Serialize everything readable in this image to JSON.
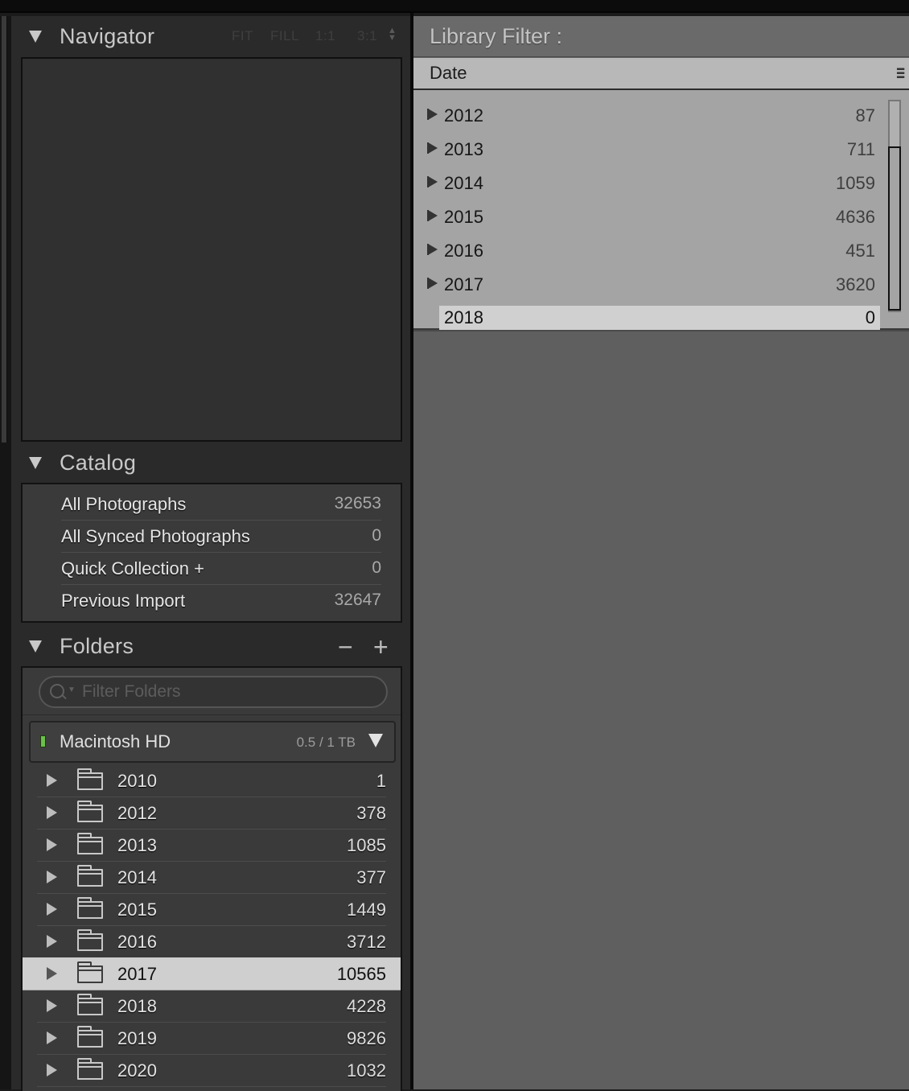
{
  "navigator": {
    "title": "Navigator",
    "options": [
      "FIT",
      "FILL",
      "1:1",
      "3:1"
    ]
  },
  "catalog": {
    "title": "Catalog",
    "items": [
      {
        "label": "All Photographs",
        "count": "32653"
      },
      {
        "label": "All Synced Photographs",
        "count": "0"
      },
      {
        "label": "Quick Collection +",
        "count": "0"
      },
      {
        "label": "Previous Import",
        "count": "32647"
      }
    ]
  },
  "folders": {
    "title": "Folders",
    "remove_label": "−",
    "add_label": "+",
    "search_placeholder": "Filter Folders",
    "volume": {
      "name": "Macintosh HD",
      "capacity": "0.5 / 1 TB",
      "status_color": "#6cc04a"
    },
    "items": [
      {
        "name": "2010",
        "count": "1"
      },
      {
        "name": "2012",
        "count": "378"
      },
      {
        "name": "2013",
        "count": "1085"
      },
      {
        "name": "2014",
        "count": "377"
      },
      {
        "name": "2015",
        "count": "1449"
      },
      {
        "name": "2016",
        "count": "3712"
      },
      {
        "name": "2017",
        "count": "10565",
        "selected": true
      },
      {
        "name": "2018",
        "count": "4228"
      },
      {
        "name": "2019",
        "count": "9826"
      },
      {
        "name": "2020",
        "count": "1032"
      }
    ]
  },
  "library_filter": {
    "title": "Library Filter :",
    "column_label": "Date",
    "dates": [
      {
        "year": "2012",
        "count": "87"
      },
      {
        "year": "2013",
        "count": "711"
      },
      {
        "year": "2014",
        "count": "1059"
      },
      {
        "year": "2015",
        "count": "4636"
      },
      {
        "year": "2016",
        "count": "451"
      },
      {
        "year": "2017",
        "count": "3620"
      },
      {
        "year": "2018",
        "count": "0",
        "selected": true
      }
    ]
  },
  "icons": {
    "panel_collapse": "triangle-down-icon",
    "folder": "folder-icon",
    "disclosure": "triangle-right-icon",
    "search": "search-icon",
    "column_menu": "column-menu-icon"
  },
  "colors": {
    "panel_bg": "#2a2a2a",
    "filter_bg": "#a4a4a4",
    "selection": "#cfcfcf"
  }
}
